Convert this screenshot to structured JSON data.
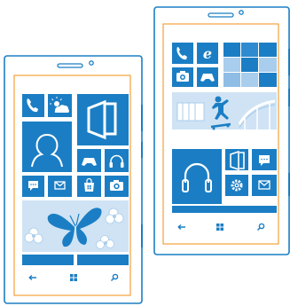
{
  "colors": {
    "outline": "#1b7ec4",
    "tile": "#1b7ec4",
    "tile_light": "#a9cdec",
    "screen_frame": "#f2a13a",
    "background": "#ffffff"
  },
  "phones": [
    {
      "name": "left-phone",
      "icons": [
        "phone-icon",
        "weather-icon",
        "office-icon",
        "people-icon",
        "games-icon",
        "music-icon",
        "messaging-icon",
        "mail-icon",
        "store-icon",
        "camera-icon",
        "butterfly-image",
        "back-icon",
        "windows-icon",
        "search-icon"
      ]
    },
    {
      "name": "right-phone",
      "icons": [
        "phone-icon",
        "internet-explorer-icon",
        "camera-icon",
        "games-icon",
        "skateboarder-image",
        "music-icon",
        "office-icon",
        "messaging-icon",
        "settings-icon",
        "mail-icon",
        "back-icon",
        "windows-icon",
        "search-icon"
      ]
    }
  ]
}
